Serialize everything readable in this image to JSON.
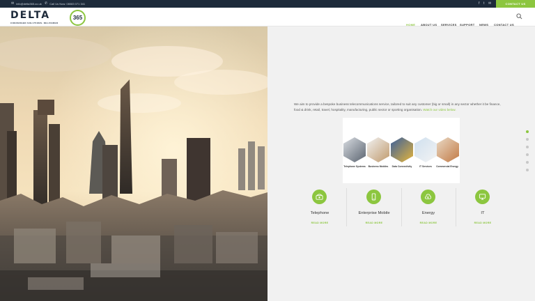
{
  "topbar": {
    "email": "info@delta365.co.uk",
    "phone": "Call Us Now: 08083 071 341",
    "contact_button": "CONTACT US",
    "social": [
      "facebook-icon",
      "twitter-icon",
      "email-icon"
    ]
  },
  "logo": {
    "word": "DELTA",
    "number": "365",
    "tagline": "CONVERGED SOLUTIONS. DELIVERED"
  },
  "nav": {
    "items": [
      {
        "label": "HOME",
        "active": true
      },
      {
        "label": "ABOUT US",
        "active": false
      },
      {
        "label": "SERVICES",
        "active": false
      },
      {
        "label": "SUPPORT",
        "active": false
      },
      {
        "label": "NEWS",
        "active": false
      },
      {
        "label": "CONTACT US",
        "active": false
      }
    ]
  },
  "intro": {
    "text": "We aim to provide a bespoke business telecommunications service, tailored to suit any customer (big or small) in any sector whether it be finance, food & drink, retail, travel, hospitality, manufacturing, public sector or sporting organisation.",
    "link": "Watch our video below."
  },
  "services_image": {
    "labels": [
      "Telephone Systems",
      "Business Mobiles",
      "Data Connectivity",
      "IT Services",
      "Commercial Energy"
    ]
  },
  "services": [
    {
      "title": "Telephone",
      "more": "READ MORE",
      "icon": "telephone-icon"
    },
    {
      "title": "Enterprise Mobile",
      "more": "READ MORE",
      "icon": "mobile-icon"
    },
    {
      "title": "Energy",
      "more": "READ MORE",
      "icon": "energy-icon"
    },
    {
      "title": "IT",
      "more": "READ MORE",
      "icon": "it-icon"
    }
  ],
  "section_dots": {
    "count": 6,
    "active_index": 0
  },
  "colors": {
    "accent": "#8cc63f",
    "dark": "#1d2a3a"
  }
}
